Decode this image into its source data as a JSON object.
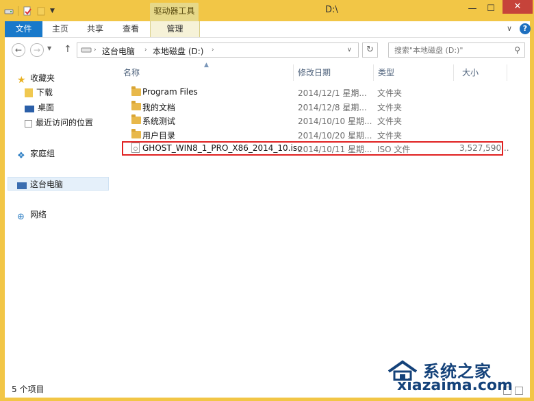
{
  "window": {
    "title": "D:\\"
  },
  "ribbon": {
    "contextual_group": "驱动器工具",
    "tabs": [
      {
        "label": "文件"
      },
      {
        "label": "主页"
      },
      {
        "label": "共享"
      },
      {
        "label": "查看"
      },
      {
        "label": "管理"
      }
    ]
  },
  "address": {
    "breadcrumb": [
      "这台电脑",
      "本地磁盘 (D:)"
    ]
  },
  "search": {
    "placeholder": "搜索\"本地磁盘 (D:)\""
  },
  "nav": {
    "favorites_label": "收藏夹",
    "favorites": [
      {
        "label": "下载"
      },
      {
        "label": "桌面"
      },
      {
        "label": "最近访问的位置"
      }
    ],
    "homegroup": "家庭组",
    "this_pc": "这台电脑",
    "network": "网络"
  },
  "columns": {
    "name": "名称",
    "date": "修改日期",
    "type": "类型",
    "size": "大小"
  },
  "files": [
    {
      "name": "Program Files",
      "date": "2014/12/1 星期...",
      "type": "文件夹",
      "size": ""
    },
    {
      "name": "我的文档",
      "date": "2014/12/8 星期...",
      "type": "文件夹",
      "size": ""
    },
    {
      "name": "系统测试",
      "date": "2014/10/10 星期...",
      "type": "文件夹",
      "size": ""
    },
    {
      "name": "用户目录",
      "date": "2014/10/20 星期...",
      "type": "文件夹",
      "size": ""
    },
    {
      "name": "GHOST_WIN8_1_PRO_X86_2014_10.iso",
      "date": "2014/10/11 星期...",
      "type": "ISO 文件",
      "size": "3,527,590..."
    }
  ],
  "status": {
    "item_count": "5 个项目"
  },
  "watermark": {
    "cn": "系统之家",
    "en": "xiazaima.com"
  },
  "colors": {
    "accent": "#1979ca",
    "frame": "#f2c646",
    "highlight": "#e02020"
  }
}
